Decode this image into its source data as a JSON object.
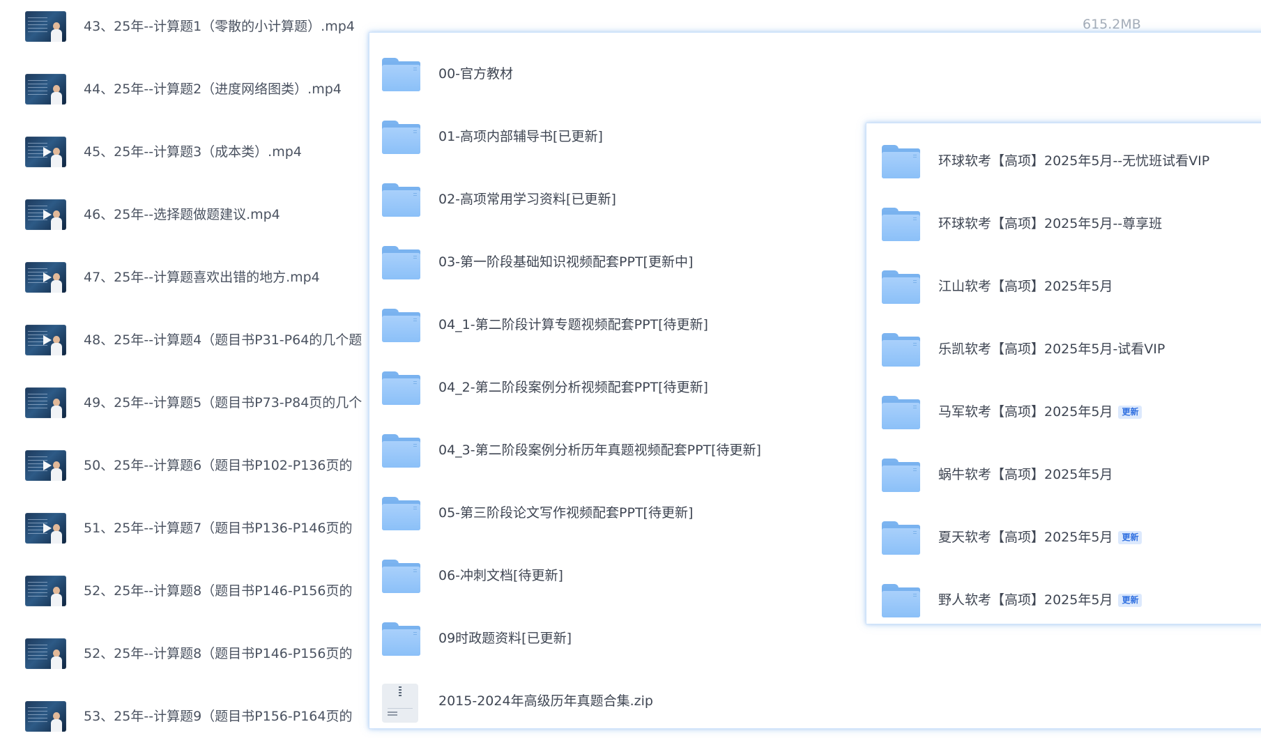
{
  "background_list": {
    "size_label": "615.2MB",
    "videos": [
      {
        "name": "43、25年--计算题1（零散的小计算题）.mp4",
        "play_icon": false
      },
      {
        "name": "44、25年--计算题2（进度网络图类）.mp4",
        "play_icon": false
      },
      {
        "name": "45、25年--计算题3（成本类）.mp4",
        "play_icon": true
      },
      {
        "name": "46、25年--选择题做题建议.mp4",
        "play_icon": true
      },
      {
        "name": "47、25年--计算题喜欢出错的地方.mp4",
        "play_icon": true
      },
      {
        "name": "48、25年--计算题4（题目书P31-P64的几个题",
        "play_icon": true
      },
      {
        "name": "49、25年--计算题5（题目书P73-P84页的几个",
        "play_icon": false
      },
      {
        "name": "50、25年--计算题6（题目书P102-P136页的",
        "play_icon": true
      },
      {
        "name": "51、25年--计算题7（题目书P136-P146页的",
        "play_icon": true
      },
      {
        "name": "52、25年--计算题8（题目书P146-P156页的",
        "play_icon": false
      },
      {
        "name": "52、25年--计算题8（题目书P146-P156页的",
        "play_icon": false
      },
      {
        "name": "53、25年--计算题9（题目书P156-P164页的",
        "play_icon": false
      }
    ]
  },
  "main_panel": {
    "items": [
      {
        "name": "00-官方教材",
        "icon": "folder-icon"
      },
      {
        "name": "01-高项内部辅导书[已更新]",
        "icon": "folder-icon"
      },
      {
        "name": "02-高项常用学习资料[已更新]",
        "icon": "folder-icon"
      },
      {
        "name": "03-第一阶段基础知识视频配套PPT[更新中]",
        "icon": "folder-icon"
      },
      {
        "name": "04_1-第二阶段计算专题视频配套PPT[待更新]",
        "icon": "folder-icon"
      },
      {
        "name": "04_2-第二阶段案例分析视频配套PPT[待更新]",
        "icon": "folder-icon"
      },
      {
        "name": "04_3-第二阶段案例分析历年真题视频配套PPT[待更新]",
        "icon": "folder-icon"
      },
      {
        "name": "05-第三阶段论文写作视频配套PPT[待更新]",
        "icon": "folder-icon"
      },
      {
        "name": "06-冲刺文档[待更新]",
        "icon": "folder-icon"
      },
      {
        "name": "09时政题资料[已更新]",
        "icon": "folder-icon"
      },
      {
        "name": "2015-2024年高级历年真题合集.zip",
        "icon": "zip-icon"
      }
    ]
  },
  "sub_panel": {
    "items": [
      {
        "name": "环球软考【高项】2025年5月--无忧班试看VIP",
        "badge": ""
      },
      {
        "name": "环球软考【高项】2025年5月--尊享班",
        "badge": ""
      },
      {
        "name": "江山软考【高项】2025年5月",
        "badge": ""
      },
      {
        "name": "乐凯软考【高项】2025年5月-试看VIP",
        "badge": ""
      },
      {
        "name": "马军软考【高项】2025年5月",
        "badge": "更新"
      },
      {
        "name": "蜗牛软考【高项】2025年5月",
        "badge": ""
      },
      {
        "name": "夏天软考【高项】2025年5月",
        "badge": "更新"
      },
      {
        "name": "野人软考【高项】2025年5月",
        "badge": "更新"
      }
    ]
  }
}
